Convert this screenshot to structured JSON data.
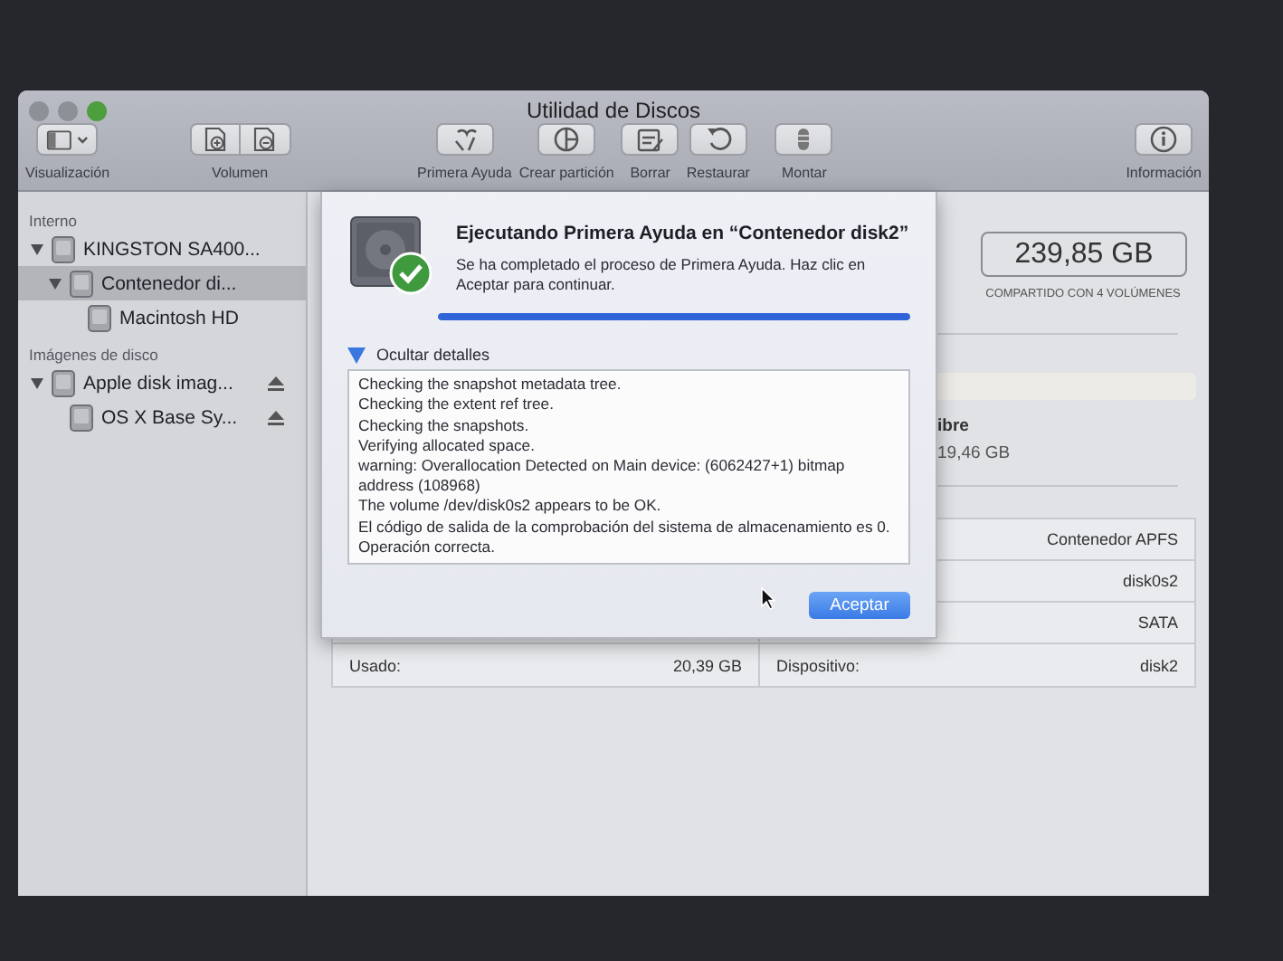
{
  "window": {
    "title": "Utilidad de Discos"
  },
  "toolbar": [
    {
      "label": "Visualización",
      "kind": "view"
    },
    {
      "label": "Volumen",
      "kind": "volume"
    },
    {
      "label": "Primera Ayuda",
      "kind": "first-aid"
    },
    {
      "label": "Crear partición",
      "kind": "partition"
    },
    {
      "label": "Borrar",
      "kind": "erase"
    },
    {
      "label": "Restaurar",
      "kind": "restore"
    },
    {
      "label": "Montar",
      "kind": "mount"
    },
    {
      "label": "Información",
      "kind": "info"
    }
  ],
  "sidebar": {
    "sections": [
      {
        "title": "Interno",
        "items": [
          {
            "name": "KINGSTON SA400...",
            "expanded": true,
            "selected": false,
            "children": [
              {
                "name": "Contenedor di...",
                "expanded": true,
                "selected": true,
                "children": [
                  {
                    "name": "Macintosh HD",
                    "selected": false
                  }
                ]
              }
            ]
          }
        ]
      },
      {
        "title": "Imágenes de disco",
        "items": [
          {
            "name": "Apple disk imag...",
            "expanded": true,
            "selected": false,
            "ejectable": true,
            "children": [
              {
                "name": "OS X Base Sy...",
                "selected": false,
                "ejectable": true
              }
            ]
          }
        ]
      }
    ]
  },
  "main": {
    "capacity": "239,85 GB",
    "capacity_note": "COMPARTIDO CON 4 VOLÚMENES",
    "free_label": "ibre",
    "free_value": "19,46 GB",
    "info_rows": [
      {
        "right_value": "Contenedor APFS"
      },
      {
        "right_value": "disk0s2"
      },
      {
        "right_value": "SATA"
      },
      {
        "left_label": "Usado:",
        "left_value": "20,39 GB",
        "right_label": "Dispositivo:",
        "right_value": "disk2"
      }
    ]
  },
  "sheet": {
    "title": "Ejecutando Primera Ayuda en “Contenedor disk2”",
    "message": "Se ha completado el proceso de Primera Ayuda. Haz clic en Aceptar para continuar.",
    "progress": {
      "level": 1.0
    },
    "details_toggle": {
      "label": "Ocultar detalles",
      "expanded": true
    },
    "log": [
      "Checking the snapshot metadata tree.",
      "Checking the extent ref tree.",
      "Checking the snapshots.",
      "Verifying allocated space.",
      "warning: Overallocation Detected on Main device: (6062427+1) bitmap address (108968)",
      "The volume /dev/disk0s2 appears to be OK.",
      "El código de salida de la comprobación del sistema de almacenamiento es 0.",
      "Operación correcta."
    ],
    "button": "Aceptar"
  }
}
